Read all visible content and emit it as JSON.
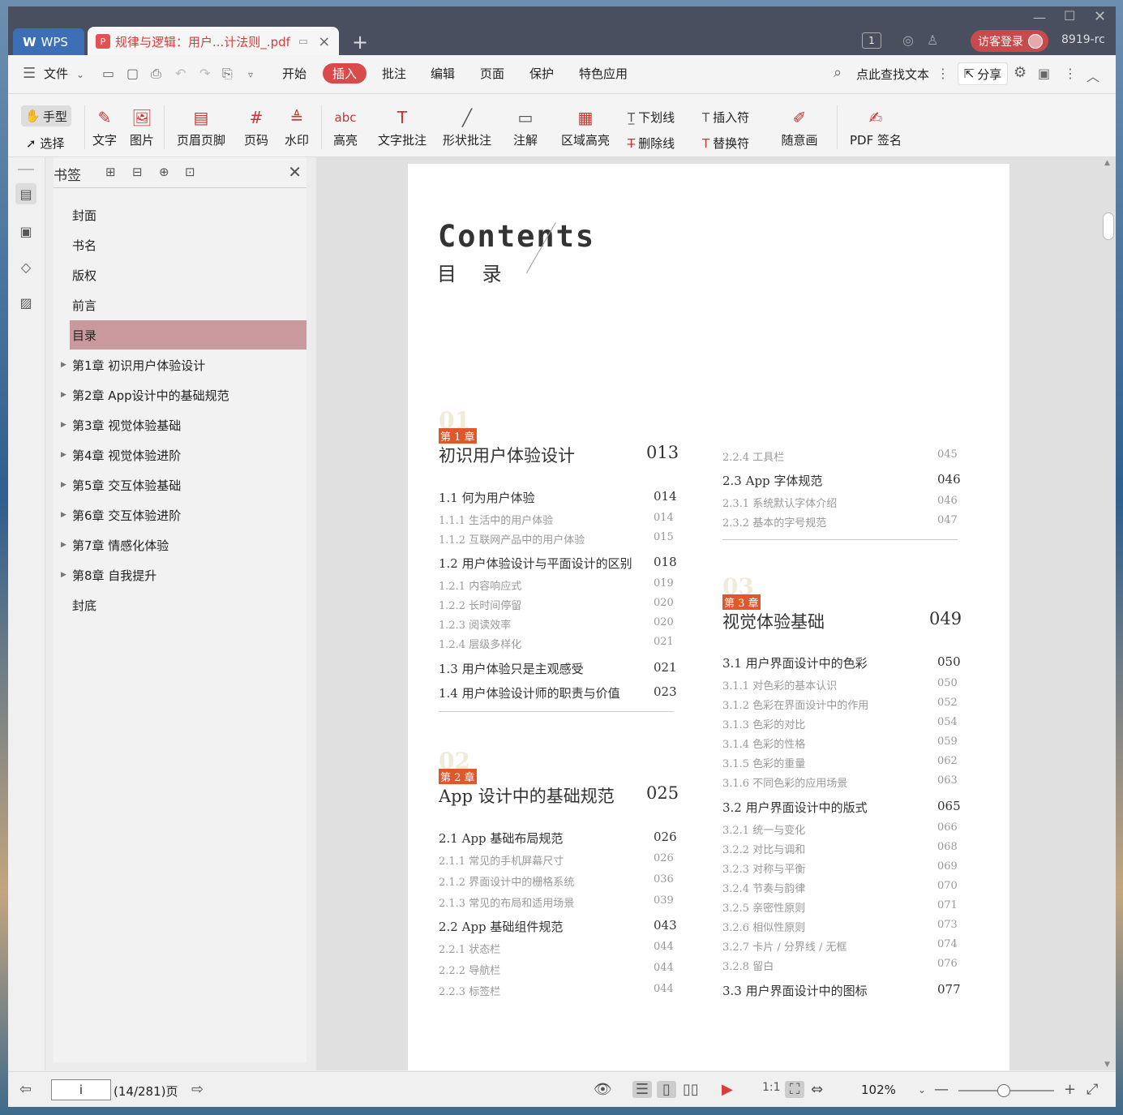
{
  "titlebar": {
    "app_tab": "WPS",
    "doc_tab": "规律与逻辑：用户...计法则_.pdf",
    "page_count": "1",
    "visitor_login": "访客登录",
    "version": "8919-rc"
  },
  "menubar": {
    "file": "文件",
    "items": [
      "开始",
      "插入",
      "批注",
      "编辑",
      "页面",
      "保护",
      "特色应用"
    ],
    "active": "插入",
    "search": "点此查找文本",
    "share": "分享"
  },
  "ribbon": {
    "hand": "手型",
    "select": "选择",
    "text": "文字",
    "image": "图片",
    "header_footer": "页眉页脚",
    "page_num": "页码",
    "watermark": "水印",
    "highlight": "高亮",
    "text_annot": "文字批注",
    "shape_annot": "形状批注",
    "note": "注解",
    "area_highlight": "区域高亮",
    "underline": "下划线",
    "strikethrough": "删除线",
    "insert_sym": "插入符",
    "replace_sym": "替换符",
    "freehand": "随意画",
    "pdf_sign": "PDF 签名"
  },
  "bookmarks": {
    "title": "书签",
    "items": [
      {
        "label": "封面",
        "expandable": false
      },
      {
        "label": "书名",
        "expandable": false
      },
      {
        "label": "版权",
        "expandable": false
      },
      {
        "label": "前言",
        "expandable": false
      },
      {
        "label": "目录",
        "expandable": false,
        "selected": true
      },
      {
        "label": "第1章 初识用户体验设计",
        "expandable": true
      },
      {
        "label": "第2章 App设计中的基础规范",
        "expandable": true
      },
      {
        "label": "第3章 视觉体验基础",
        "expandable": true
      },
      {
        "label": "第4章 视觉体验进阶",
        "expandable": true
      },
      {
        "label": "第5章 交互体验基础",
        "expandable": true
      },
      {
        "label": "第6章 交互体验进阶",
        "expandable": true
      },
      {
        "label": "第7章 情感化体验",
        "expandable": true
      },
      {
        "label": "第8章 自我提升",
        "expandable": true
      },
      {
        "label": "封底",
        "expandable": false
      }
    ]
  },
  "page": {
    "contents_en": "Contents",
    "contents_zh": "目 录",
    "ch1": {
      "num": "01",
      "badge": "第 1 章",
      "title": "初识用户体验设计",
      "page": "013"
    },
    "ch1_items": [
      {
        "t": "1.1  何为用户体验",
        "p": "014",
        "lvl": 2
      },
      {
        "t": "1.1.1  生活中的用户体验",
        "p": "014",
        "lvl": 3
      },
      {
        "t": "1.1.2  互联网产品中的用户体验",
        "p": "015",
        "lvl": 3
      },
      {
        "t": "1.2  用户体验设计与平面设计的区别",
        "p": "018",
        "lvl": 2
      },
      {
        "t": "1.2.1  内容响应式",
        "p": "019",
        "lvl": 3
      },
      {
        "t": "1.2.2  长时间停留",
        "p": "020",
        "lvl": 3
      },
      {
        "t": "1.2.3  阅读效率",
        "p": "020",
        "lvl": 3
      },
      {
        "t": "1.2.4  层级多样化",
        "p": "021",
        "lvl": 3
      },
      {
        "t": "1.3  用户体验只是主观感受",
        "p": "021",
        "lvl": 2
      },
      {
        "t": "1.4  用户体验设计师的职责与价值",
        "p": "023",
        "lvl": 2
      }
    ],
    "ch2": {
      "num": "02",
      "badge": "第 2 章",
      "title": "App 设计中的基础规范",
      "page": "025"
    },
    "ch2_items": [
      {
        "t": "2.1  App 基础布局规范",
        "p": "026",
        "lvl": 2
      },
      {
        "t": "2.1.1  常见的手机屏幕尺寸",
        "p": "026",
        "lvl": 3
      },
      {
        "t": "2.1.2  界面设计中的栅格系统",
        "p": "036",
        "lvl": 3
      },
      {
        "t": "2.1.3  常见的布局和适用场景",
        "p": "039",
        "lvl": 3
      },
      {
        "t": "2.2  App 基础组件规范",
        "p": "043",
        "lvl": 2
      },
      {
        "t": "2.2.1  状态栏",
        "p": "044",
        "lvl": 3
      },
      {
        "t": "2.2.2  导航栏",
        "p": "044",
        "lvl": 3
      },
      {
        "t": "2.2.3  标签栏",
        "p": "044",
        "lvl": 3
      }
    ],
    "right_items": [
      {
        "t": "2.2.4  工具栏",
        "p": "045",
        "lvl": 3
      },
      {
        "t": "2.3  App 字体规范",
        "p": "046",
        "lvl": 2
      },
      {
        "t": "2.3.1  系统默认字体介绍",
        "p": "046",
        "lvl": 3
      },
      {
        "t": "2.3.2  基本的字号规范",
        "p": "047",
        "lvl": 3
      }
    ],
    "ch3": {
      "num": "03",
      "badge": "第 3 章",
      "title": "视觉体验基础",
      "page": "049"
    },
    "ch3_items": [
      {
        "t": "3.1  用户界面设计中的色彩",
        "p": "050",
        "lvl": 2
      },
      {
        "t": "3.1.1  对色彩的基本认识",
        "p": "050",
        "lvl": 3
      },
      {
        "t": "3.1.2  色彩在界面设计中的作用",
        "p": "052",
        "lvl": 3
      },
      {
        "t": "3.1.3  色彩的对比",
        "p": "054",
        "lvl": 3
      },
      {
        "t": "3.1.4  色彩的性格",
        "p": "059",
        "lvl": 3
      },
      {
        "t": "3.1.5  色彩的重量",
        "p": "062",
        "lvl": 3
      },
      {
        "t": "3.1.6  不同色彩的应用场景",
        "p": "063",
        "lvl": 3
      },
      {
        "t": "3.2  用户界面设计中的版式",
        "p": "065",
        "lvl": 2
      },
      {
        "t": "3.2.1  统一与变化",
        "p": "066",
        "lvl": 3
      },
      {
        "t": "3.2.2  对比与调和",
        "p": "068",
        "lvl": 3
      },
      {
        "t": "3.2.3  对称与平衡",
        "p": "069",
        "lvl": 3
      },
      {
        "t": "3.2.4  节奏与韵律",
        "p": "070",
        "lvl": 3
      },
      {
        "t": "3.2.5  亲密性原则",
        "p": "071",
        "lvl": 3
      },
      {
        "t": "3.2.6  相似性原则",
        "p": "073",
        "lvl": 3
      },
      {
        "t": "3.2.7  卡片 / 分界线 / 无框",
        "p": "074",
        "lvl": 3
      },
      {
        "t": "3.2.8  留白",
        "p": "076",
        "lvl": 3
      },
      {
        "t": "3.3  用户界面设计中的图标",
        "p": "077",
        "lvl": 2
      }
    ]
  },
  "status": {
    "page_input": "i",
    "page_info": "(14/281)页",
    "zoom": "102%"
  }
}
